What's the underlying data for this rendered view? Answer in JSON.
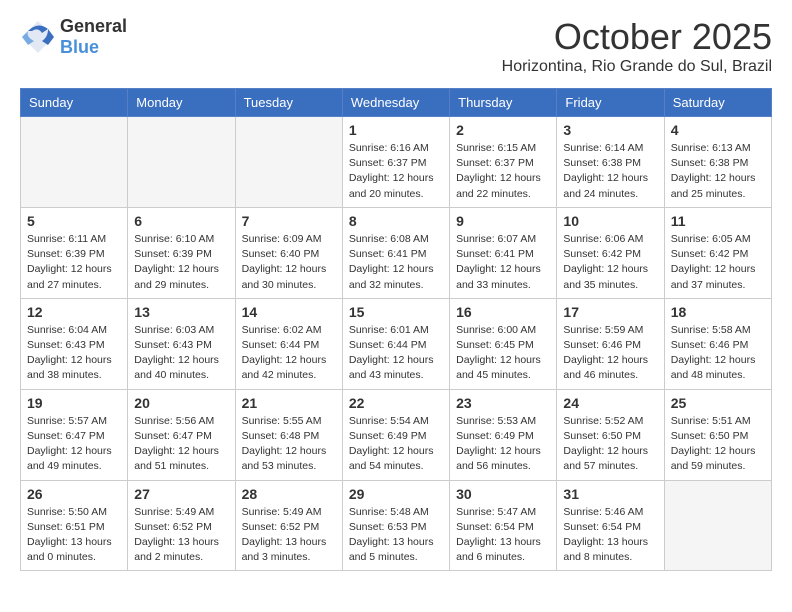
{
  "header": {
    "logo_general": "General",
    "logo_blue": "Blue",
    "month": "October 2025",
    "location": "Horizontina, Rio Grande do Sul, Brazil"
  },
  "days_of_week": [
    "Sunday",
    "Monday",
    "Tuesday",
    "Wednesday",
    "Thursday",
    "Friday",
    "Saturday"
  ],
  "weeks": [
    [
      {
        "day": "",
        "empty": true
      },
      {
        "day": "",
        "empty": true
      },
      {
        "day": "",
        "empty": true
      },
      {
        "day": "1",
        "sunrise": "6:16 AM",
        "sunset": "6:37 PM",
        "daylight": "12 hours and 20 minutes."
      },
      {
        "day": "2",
        "sunrise": "6:15 AM",
        "sunset": "6:37 PM",
        "daylight": "12 hours and 22 minutes."
      },
      {
        "day": "3",
        "sunrise": "6:14 AM",
        "sunset": "6:38 PM",
        "daylight": "12 hours and 24 minutes."
      },
      {
        "day": "4",
        "sunrise": "6:13 AM",
        "sunset": "6:38 PM",
        "daylight": "12 hours and 25 minutes."
      }
    ],
    [
      {
        "day": "5",
        "sunrise": "6:11 AM",
        "sunset": "6:39 PM",
        "daylight": "12 hours and 27 minutes."
      },
      {
        "day": "6",
        "sunrise": "6:10 AM",
        "sunset": "6:39 PM",
        "daylight": "12 hours and 29 minutes."
      },
      {
        "day": "7",
        "sunrise": "6:09 AM",
        "sunset": "6:40 PM",
        "daylight": "12 hours and 30 minutes."
      },
      {
        "day": "8",
        "sunrise": "6:08 AM",
        "sunset": "6:41 PM",
        "daylight": "12 hours and 32 minutes."
      },
      {
        "day": "9",
        "sunrise": "6:07 AM",
        "sunset": "6:41 PM",
        "daylight": "12 hours and 33 minutes."
      },
      {
        "day": "10",
        "sunrise": "6:06 AM",
        "sunset": "6:42 PM",
        "daylight": "12 hours and 35 minutes."
      },
      {
        "day": "11",
        "sunrise": "6:05 AM",
        "sunset": "6:42 PM",
        "daylight": "12 hours and 37 minutes."
      }
    ],
    [
      {
        "day": "12",
        "sunrise": "6:04 AM",
        "sunset": "6:43 PM",
        "daylight": "12 hours and 38 minutes."
      },
      {
        "day": "13",
        "sunrise": "6:03 AM",
        "sunset": "6:43 PM",
        "daylight": "12 hours and 40 minutes."
      },
      {
        "day": "14",
        "sunrise": "6:02 AM",
        "sunset": "6:44 PM",
        "daylight": "12 hours and 42 minutes."
      },
      {
        "day": "15",
        "sunrise": "6:01 AM",
        "sunset": "6:44 PM",
        "daylight": "12 hours and 43 minutes."
      },
      {
        "day": "16",
        "sunrise": "6:00 AM",
        "sunset": "6:45 PM",
        "daylight": "12 hours and 45 minutes."
      },
      {
        "day": "17",
        "sunrise": "5:59 AM",
        "sunset": "6:46 PM",
        "daylight": "12 hours and 46 minutes."
      },
      {
        "day": "18",
        "sunrise": "5:58 AM",
        "sunset": "6:46 PM",
        "daylight": "12 hours and 48 minutes."
      }
    ],
    [
      {
        "day": "19",
        "sunrise": "5:57 AM",
        "sunset": "6:47 PM",
        "daylight": "12 hours and 49 minutes."
      },
      {
        "day": "20",
        "sunrise": "5:56 AM",
        "sunset": "6:47 PM",
        "daylight": "12 hours and 51 minutes."
      },
      {
        "day": "21",
        "sunrise": "5:55 AM",
        "sunset": "6:48 PM",
        "daylight": "12 hours and 53 minutes."
      },
      {
        "day": "22",
        "sunrise": "5:54 AM",
        "sunset": "6:49 PM",
        "daylight": "12 hours and 54 minutes."
      },
      {
        "day": "23",
        "sunrise": "5:53 AM",
        "sunset": "6:49 PM",
        "daylight": "12 hours and 56 minutes."
      },
      {
        "day": "24",
        "sunrise": "5:52 AM",
        "sunset": "6:50 PM",
        "daylight": "12 hours and 57 minutes."
      },
      {
        "day": "25",
        "sunrise": "5:51 AM",
        "sunset": "6:50 PM",
        "daylight": "12 hours and 59 minutes."
      }
    ],
    [
      {
        "day": "26",
        "sunrise": "5:50 AM",
        "sunset": "6:51 PM",
        "daylight": "13 hours and 0 minutes."
      },
      {
        "day": "27",
        "sunrise": "5:49 AM",
        "sunset": "6:52 PM",
        "daylight": "13 hours and 2 minutes."
      },
      {
        "day": "28",
        "sunrise": "5:49 AM",
        "sunset": "6:52 PM",
        "daylight": "13 hours and 3 minutes."
      },
      {
        "day": "29",
        "sunrise": "5:48 AM",
        "sunset": "6:53 PM",
        "daylight": "13 hours and 5 minutes."
      },
      {
        "day": "30",
        "sunrise": "5:47 AM",
        "sunset": "6:54 PM",
        "daylight": "13 hours and 6 minutes."
      },
      {
        "day": "31",
        "sunrise": "5:46 AM",
        "sunset": "6:54 PM",
        "daylight": "13 hours and 8 minutes."
      },
      {
        "day": "",
        "empty": true
      }
    ]
  ]
}
